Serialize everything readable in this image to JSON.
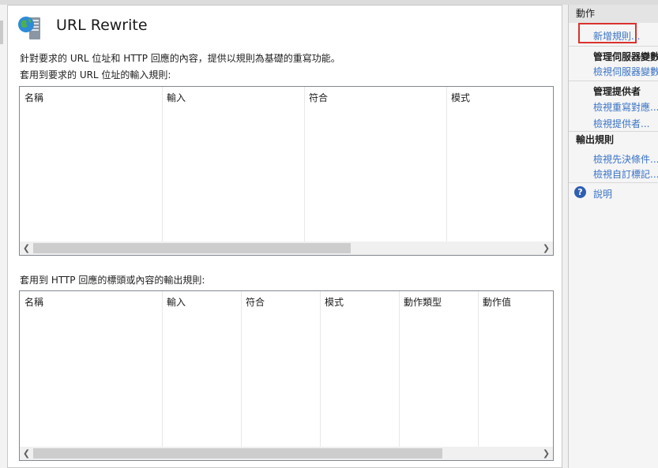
{
  "page": {
    "title": "URL Rewrite",
    "description": "針對要求的 URL 位址和 HTTP 回應的內容，提供以規則為基礎的重寫功能。"
  },
  "inbound": {
    "label": "套用到要求的 URL 位址的輸入規則:",
    "columns": [
      "名稱",
      "輸入",
      "符合",
      "模式"
    ]
  },
  "outbound": {
    "label": "套用到 HTTP 回應的標頭或內容的輸出規則:",
    "columns": [
      "名稱",
      "輸入",
      "符合",
      "模式",
      "動作類型",
      "動作值"
    ]
  },
  "actions": {
    "title": "動作",
    "add_rule": "新增規則...",
    "server_vars_heading": "管理伺服器變數",
    "view_server_vars": "檢視伺服器變數",
    "providers_heading": "管理提供者",
    "view_rewrite_maps": "檢視重寫對應...",
    "view_providers": "檢視提供者...",
    "outbound_heading": "輸出規則",
    "view_preconditions": "檢視先決條件...",
    "view_custom_tags": "檢視自訂標記...",
    "help": "說明"
  },
  "icons": {
    "feature": "url-rewrite-globe-server-icon",
    "help": "help-icon",
    "scroll_left": "chevron-left-icon",
    "scroll_right": "chevron-right-icon"
  },
  "colors": {
    "link": "#3a73c5",
    "highlight_border": "#d9322e",
    "pane_header": "#e4e4e4"
  }
}
